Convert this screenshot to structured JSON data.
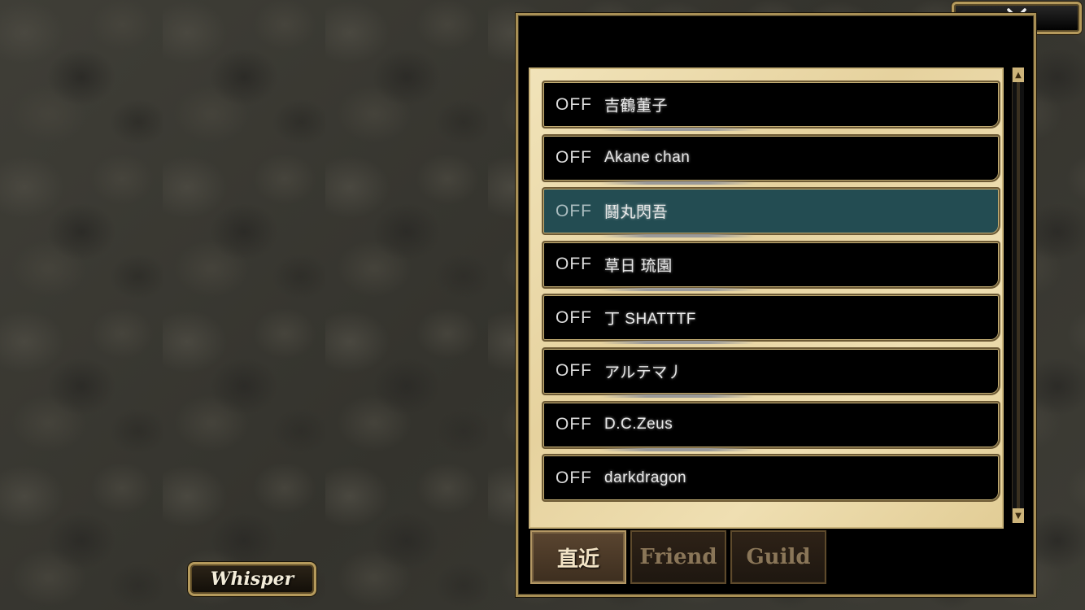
{
  "window": {
    "close_icon": "close-x-icon"
  },
  "players": [
    {
      "status": "OFF",
      "name": "吉鶴董子",
      "selected": false
    },
    {
      "status": "OFF",
      "name": "Akane chan",
      "selected": false
    },
    {
      "status": "OFF",
      "name": "鬪丸閃吾",
      "selected": true
    },
    {
      "status": "OFF",
      "name": "草日 琉園",
      "selected": false
    },
    {
      "status": "OFF",
      "name": "丁 SHATTTF",
      "selected": false
    },
    {
      "status": "OFF",
      "name": "アルテマ丿",
      "selected": false
    },
    {
      "status": "OFF",
      "name": "D.C.Zeus",
      "selected": false
    },
    {
      "status": "OFF",
      "name": "darkdragon",
      "selected": false
    }
  ],
  "tabs": [
    {
      "label": "直近",
      "active": true
    },
    {
      "label": "Friend",
      "active": false
    },
    {
      "label": "Guild",
      "active": false
    }
  ],
  "whisper_button": {
    "label": "Whisper"
  },
  "scrollbar": {
    "up_icon": "scroll-up-arrow-icon",
    "down_icon": "scroll-down-arrow-icon"
  },
  "colors": {
    "gold_border": "#b59a5c",
    "selected_row": "#234c52",
    "parchment": "#ecdcad"
  }
}
